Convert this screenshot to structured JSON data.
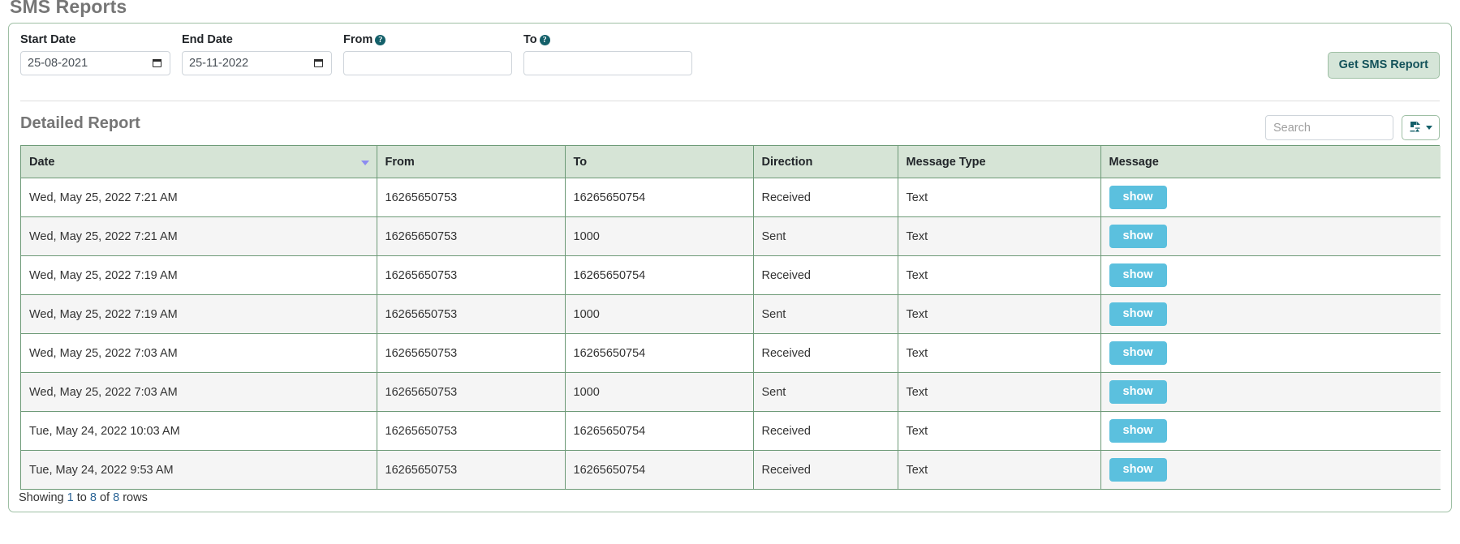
{
  "page": {
    "title": "SMS Reports"
  },
  "filters": {
    "start_date": {
      "label": "Start Date",
      "value": "25-08-2021",
      "icon": "calendar-icon"
    },
    "end_date": {
      "label": "End Date",
      "value": "25-11-2022",
      "icon": "calendar-icon"
    },
    "from": {
      "label": "From",
      "value": "",
      "placeholder": "",
      "help_icon": "?"
    },
    "to": {
      "label": "To",
      "value": "",
      "placeholder": "",
      "help_icon": "?"
    },
    "submit_label": "Get SMS Report"
  },
  "report": {
    "title": "Detailed Report",
    "search_placeholder": "Search",
    "search_value": "",
    "export_icon": "export-download-icon",
    "footer": {
      "prefix": "Showing ",
      "from": "1",
      "mid1": " to ",
      "to": "8",
      "mid2": " of ",
      "total": "8",
      "suffix": " rows"
    },
    "columns": [
      {
        "key": "date",
        "label": "Date",
        "sorted": "desc"
      },
      {
        "key": "from",
        "label": "From",
        "sorted": ""
      },
      {
        "key": "to",
        "label": "To",
        "sorted": ""
      },
      {
        "key": "direction",
        "label": "Direction",
        "sorted": ""
      },
      {
        "key": "message_type",
        "label": "Message Type",
        "sorted": ""
      },
      {
        "key": "message",
        "label": "Message",
        "sorted": ""
      }
    ],
    "show_button_label": "show",
    "rows": [
      {
        "date": "Wed, May 25, 2022 7:21 AM",
        "from": "16265650753",
        "to": "16265650754",
        "direction": "Received",
        "message_type": "Text"
      },
      {
        "date": "Wed, May 25, 2022 7:21 AM",
        "from": "16265650753",
        "to": "1000",
        "direction": "Sent",
        "message_type": "Text"
      },
      {
        "date": "Wed, May 25, 2022 7:19 AM",
        "from": "16265650753",
        "to": "16265650754",
        "direction": "Received",
        "message_type": "Text"
      },
      {
        "date": "Wed, May 25, 2022 7:19 AM",
        "from": "16265650753",
        "to": "1000",
        "direction": "Sent",
        "message_type": "Text"
      },
      {
        "date": "Wed, May 25, 2022 7:03 AM",
        "from": "16265650753",
        "to": "16265650754",
        "direction": "Received",
        "message_type": "Text"
      },
      {
        "date": "Wed, May 25, 2022 7:03 AM",
        "from": "16265650753",
        "to": "1000",
        "direction": "Sent",
        "message_type": "Text"
      },
      {
        "date": "Tue, May 24, 2022 10:03 AM",
        "from": "16265650753",
        "to": "16265650754",
        "direction": "Received",
        "message_type": "Text"
      },
      {
        "date": "Tue, May 24, 2022 9:53 AM",
        "from": "16265650753",
        "to": "16265650754",
        "direction": "Received",
        "message_type": "Text"
      }
    ]
  },
  "colors": {
    "table_header_bg": "#d6e4d6",
    "table_border": "#6d9a77",
    "show_button": "#5bc0de",
    "primary_button_bg": "#d5e5d8",
    "primary_button_text": "#13525a",
    "heading_text": "#767676",
    "sort_caret": "#8c8cf0"
  }
}
